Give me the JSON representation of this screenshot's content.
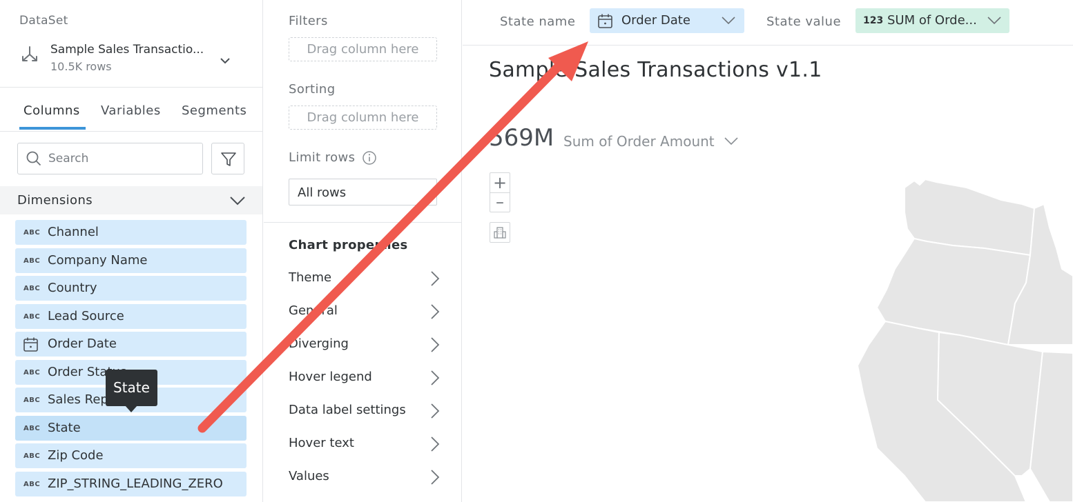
{
  "dataset": {
    "heading": "DataSet",
    "name": "Sample Sales Transactio...",
    "rows": "10.5K rows"
  },
  "tabs": [
    "Columns",
    "Variables",
    "Segments"
  ],
  "search": {
    "placeholder": "Search"
  },
  "dimensions": {
    "header": "Dimensions",
    "items": [
      {
        "type": "ABC",
        "label": "Channel"
      },
      {
        "type": "ABC",
        "label": "Company Name"
      },
      {
        "type": "ABC",
        "label": "Country"
      },
      {
        "type": "ABC",
        "label": "Lead Source"
      },
      {
        "type": "calendar-icon",
        "label": "Order Date"
      },
      {
        "type": "ABC",
        "label": "Order Status"
      },
      {
        "type": "ABC",
        "label": "Sales Rep"
      },
      {
        "type": "ABC",
        "label": "State"
      },
      {
        "type": "ABC",
        "label": "Zip Code"
      },
      {
        "type": "ABC",
        "label": "ZIP_STRING_LEADING_ZERO"
      }
    ]
  },
  "tooltip": "State",
  "middle": {
    "filters_label": "Filters",
    "filters_drop": "Drag column here",
    "sorting_label": "Sorting",
    "sorting_drop": "Drag column here",
    "limit_label": "Limit rows",
    "limit_value": "All rows",
    "chart_properties": "Chart properties",
    "properties": [
      "Theme",
      "General",
      "Diverging",
      "Hover legend",
      "Data label settings",
      "Hover text",
      "Values"
    ]
  },
  "topbar": {
    "state_name_label": "State name",
    "state_name_value": "Order Date",
    "state_value_label": "State value",
    "state_value_prefix": "123",
    "state_value_value": "SUM of Orde..."
  },
  "chart": {
    "title": "Sample Sales Transactions v1.1",
    "kpi_value": "569M",
    "kpi_label": "Sum of Order Amount",
    "zoom_in": "+",
    "zoom_out": "–"
  },
  "colors": {
    "accent": "#3d95d9",
    "field_bg": "#d6ebfc",
    "value_bg": "#d2f0e4",
    "annotation_arrow": "#f05a4f",
    "map_fill": "#e6e6e6"
  }
}
